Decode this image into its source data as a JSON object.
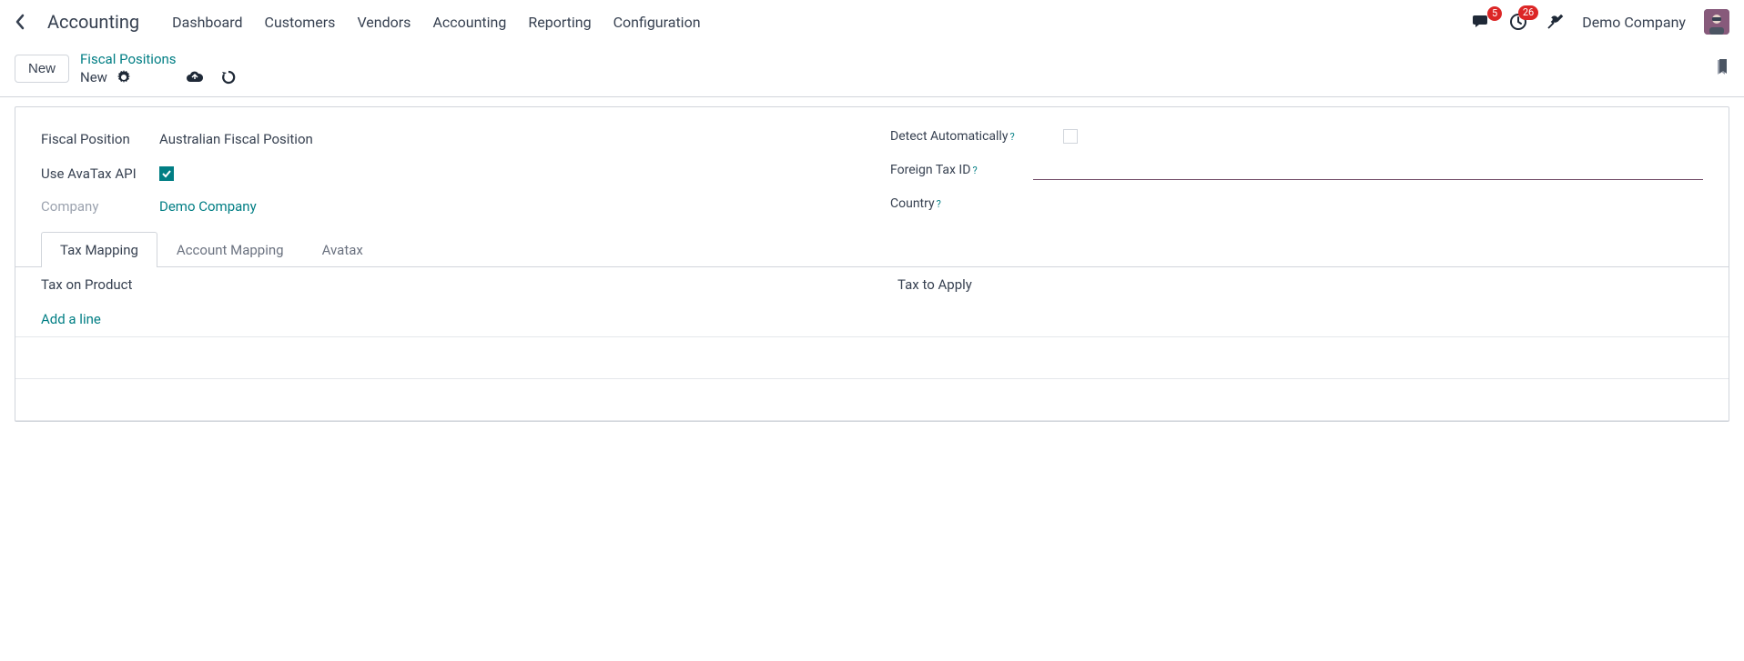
{
  "nav": {
    "app_title": "Accounting",
    "items": [
      "Dashboard",
      "Customers",
      "Vendors",
      "Accounting",
      "Reporting",
      "Configuration"
    ],
    "messages_badge": "5",
    "activities_badge": "26",
    "company": "Demo Company"
  },
  "crumb": {
    "new_button": "New",
    "parent": "Fiscal Positions",
    "current": "New"
  },
  "form": {
    "left": {
      "fiscal_position_label": "Fiscal Position",
      "fiscal_position_value": "Australian Fiscal Position",
      "use_avatax_label": "Use AvaTax API",
      "use_avatax_checked": true,
      "company_label": "Company",
      "company_value": "Demo Company"
    },
    "right": {
      "detect_auto_label": "Detect Automatically",
      "detect_auto_checked": false,
      "foreign_tax_id_label": "Foreign Tax ID",
      "foreign_tax_id_value": "",
      "country_label": "Country",
      "country_value": ""
    }
  },
  "tabs": {
    "items": [
      "Tax Mapping",
      "Account Mapping",
      "Avatax"
    ],
    "active_index": 0
  },
  "table": {
    "headers": [
      "Tax on Product",
      "Tax to Apply"
    ],
    "add_line": "Add a line"
  }
}
